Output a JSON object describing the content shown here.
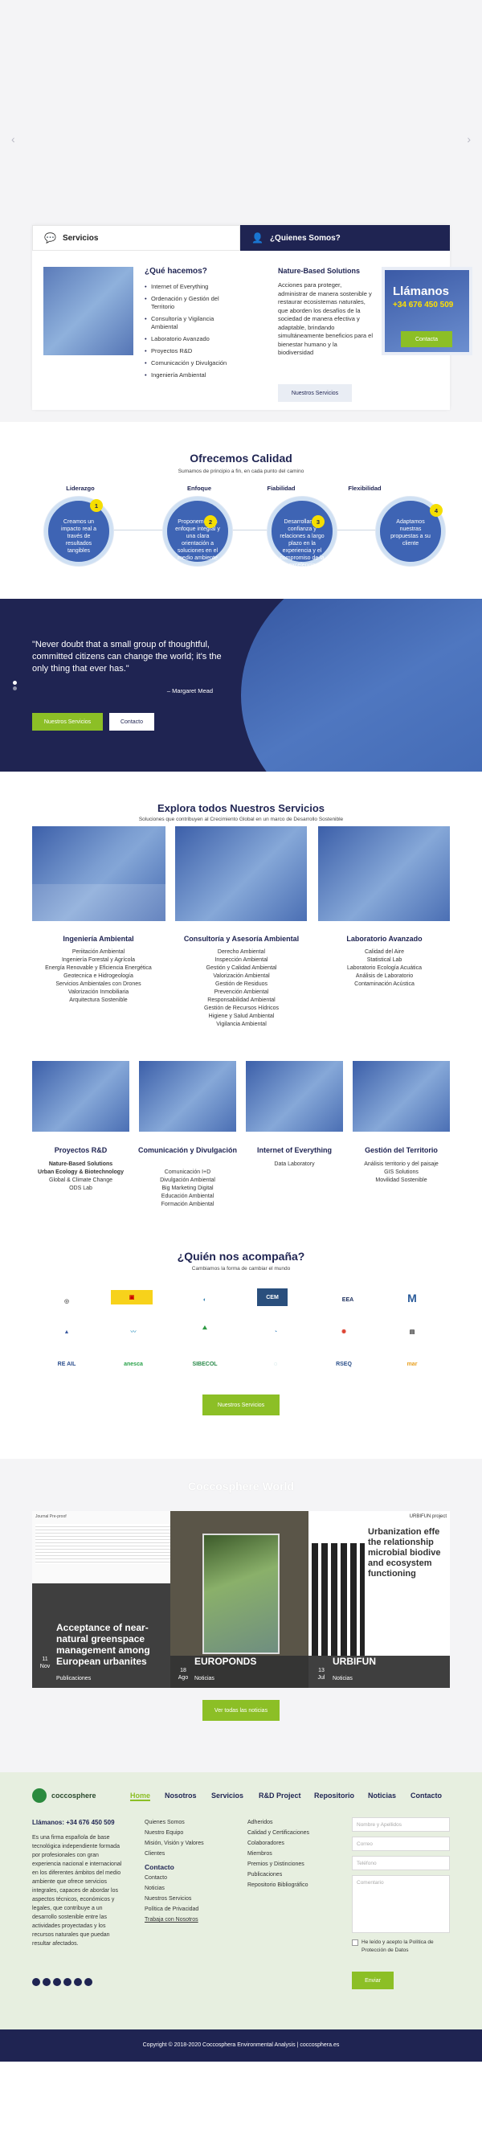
{
  "hero": {
    "prev": "‹",
    "next": "›"
  },
  "tabs": {
    "services": "Servicios",
    "about": "¿Quienes Somos?"
  },
  "services": {
    "title": "¿Qué hacemos?",
    "items": [
      "Internet of Everything",
      "Ordenación y Gestión del Territorio",
      "Consultoría y Vigilancia Ambiental",
      "Laboratorio Avanzado",
      "Proyectos R&D",
      "Comunicación y Divulgación",
      "Ingeniería Ambiental"
    ]
  },
  "about": {
    "title": "Nature-Based Solutions",
    "text": "Acciones para proteger, administrar de manera sostenible y restaurar ecosistemas naturales, que aborden los desafíos de la sociedad de manera efectiva y adaptable, brindando simultáneamente beneficios para el bienestar humano y la biodiversidad",
    "button": "Nuestros Servicios"
  },
  "call": {
    "title": "Llámanos",
    "phone": "+34 676 450 509",
    "button": "Contacta"
  },
  "quality": {
    "title": "Ofrecemos Calidad",
    "subtitle": "Sumamos de principio a fin, en cada punto del camino",
    "steps": [
      {
        "label": "Liderazgo",
        "num": "1",
        "text": "Creamos un impacto real a través de resultados tangibles"
      },
      {
        "label": "Enfoque",
        "num": "2",
        "text": "Proponemos un enfoque integral y una clara orientación a soluciones en el medio ambiente"
      },
      {
        "label": "Fiabilidad",
        "num": "3",
        "text": "Desarrollamos confianza y relaciones a largo plazo en la experiencia y el compromiso de la excelencia"
      },
      {
        "label": "Flexibilidad",
        "num": "4",
        "text": "Adaptamos nuestras propuestas a su cliente"
      }
    ]
  },
  "quote": {
    "text": "\"Never doubt that a small group of thoughtful, committed citizens can change the world; it's the only thing that ever has.\"",
    "author": "– Margaret Mead",
    "btn_services": "Nuestros Servicios",
    "btn_contact": "Contacto"
  },
  "explore": {
    "title": "Explora todos Nuestros Servicios",
    "subtitle": "Soluciones que contribuyen al Crecimiento Global en un marco de Desarrollo Sostenible",
    "row1": [
      {
        "title": "Ingeniería Ambiental",
        "items": [
          "Periitación Ambiental",
          "Ingeniería Forestal y Agrícola",
          "Energía Renovable y Eficiencia Energética",
          "Geotecnica e Hidrogeología",
          "Servicios Ambientales con Drones",
          "Valorización Inmobiliaria",
          "Arquitectura Sostenible"
        ]
      },
      {
        "title": "Consultoría y Asesoría Ambiental",
        "items": [
          "Derecho Ambiental",
          "Inspección Ambiental",
          "Gestión y Calidad Ambiental",
          "Valorización Ambiental",
          "Gestión de Residuos",
          "Prevención Ambiental",
          "Responsabilidad Ambiental",
          "Gestión de Recursos Hídricos",
          "Higiene y Salud Ambiental",
          "Vigilancia Ambiental"
        ]
      },
      {
        "title": "Laboratorio Avanzado",
        "items": [
          "Calidad del Aire",
          "Statistical Lab",
          "Laboratorio Ecología Acuática",
          "Análisis de Laboratorio",
          "Contaminación Acústica"
        ]
      }
    ],
    "row2": [
      {
        "title": "Proyectos R&D",
        "items": [
          "Nature-Based Solutions",
          "Urban Ecology & Biotechnology",
          "Global & Climate Change",
          "ODS Lab"
        ]
      },
      {
        "title": "Comunicación y Divulgación",
        "items": [
          "Comunicación I+D",
          "Divulgación Ambiental",
          "Big Marketing Digital",
          "Educación Ambiental",
          "Formación Ambiental"
        ]
      },
      {
        "title": "Internet of Everything",
        "items": [
          "Data Laboratory"
        ]
      },
      {
        "title": "Gestión del Territorio",
        "items": [
          "Análisis territorio y del paisaje",
          "GIS Solutions",
          "Movilidad Sostenible"
        ]
      }
    ]
  },
  "partners": {
    "title": "¿Quién nos acompaña?",
    "subtitle": "Cambiamos la forma de cambiar el mundo",
    "logos": [
      "",
      "",
      "",
      "CEM",
      "EEA",
      "M",
      "",
      "",
      "",
      "",
      "",
      "",
      "",
      "",
      "RE AIL",
      "anesca",
      "",
      "SIBECOL",
      "",
      "RSEQ",
      "mar"
    ],
    "button": "Nuestros Servicios"
  },
  "world": {
    "title": "Coccosphere World",
    "cards": [
      {
        "title": "Acceptance of near-natural greenspace management among European urbanites",
        "category": "Publicaciones",
        "day": "11",
        "month": "Nov"
      },
      {
        "title": "EUROPONDS",
        "category": "Noticias",
        "day": "18",
        "month": "Ago"
      },
      {
        "title": "URBIFUN",
        "category": "Noticias",
        "day": "13",
        "month": "Jul"
      }
    ],
    "card3_banner": "Urbanization effe the relationship microbial biodive and ecosystem functioning",
    "card3_tag": "URBIFUN project",
    "card1_header": "Journal Pre-proof",
    "button": "Ver todas las noticias"
  },
  "footer": {
    "logo": "coccosphere",
    "nav": [
      "Home",
      "Nosotros",
      "Servicios",
      "R&D Project",
      "Repositorio",
      "Noticias",
      "Contacto"
    ],
    "phone": "Llámanos: +34 676 450 509",
    "about": "Es una firma española de base tecnológica independiente formada por profesionales con gran experiencia nacional e internacional en los diferentes ámbitos del medio ambiente que ofrece servicios integrales, capaces de abordar los aspectos técnicos, económicos y legales, que contribuye a un desarrollo sostenible entre las actividades proyectadas y los recursos naturales que puedan resultar afectados.",
    "col1": [
      "Quienes Somos",
      "Nuestro Equipo",
      "Misión, Visión y Valores",
      "Clientes"
    ],
    "contact_title": "Contacto",
    "contact": [
      "Contacto",
      "Noticias",
      "Nuestros Servicios",
      "Política de Privacidad",
      "Trabaja con Nosotros"
    ],
    "col2": [
      "Adheridos",
      "Calidad y Certificaciones",
      "Colaboradores",
      "Miembros",
      "Premios y Distinciones",
      "Publicaciones",
      "Repositorio Bibliográfico"
    ],
    "form": {
      "name": "Nombre y Apellidos",
      "email": "Correo",
      "phone": "Teléfono",
      "message": "Comentario",
      "accept": "He leído y acepto la Política de Protección de Datos",
      "send": "Enviar"
    },
    "copyright": "Copyright © 2018-2020 Coccosphera Environmental Analysis | coccosphera.es"
  },
  "colors": {
    "navy": "#1f2452",
    "green": "#8cbf26",
    "accent_yellow": "#f5de00",
    "blue": "#3e64b4"
  }
}
